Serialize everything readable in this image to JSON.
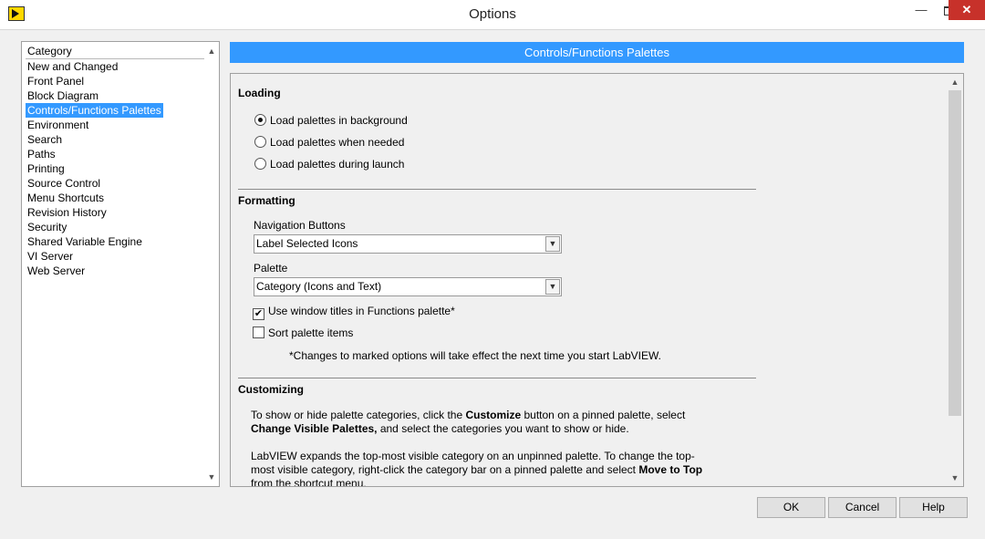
{
  "window": {
    "title": "Options"
  },
  "category_list": {
    "header": "Category",
    "items": [
      "New and Changed",
      "Front Panel",
      "Block Diagram",
      "Controls/Functions Palettes",
      "Environment",
      "Search",
      "Paths",
      "Printing",
      "Source Control",
      "Menu Shortcuts",
      "Revision History",
      "Security",
      "Shared Variable Engine",
      "VI Server",
      "Web Server"
    ],
    "selected": "Controls/Functions Palettes"
  },
  "panel": {
    "header": "Controls/Functions Palettes",
    "loading": {
      "title": "Loading",
      "options": [
        "Load palettes in background",
        "Load palettes when needed",
        "Load palettes during launch"
      ],
      "selected_index": 0
    },
    "formatting": {
      "title": "Formatting",
      "nav_label": "Navigation Buttons",
      "nav_value": "Label Selected Icons",
      "palette_label": "Palette",
      "palette_value": "Category (Icons and Text)",
      "use_window_titles": "Use window titles in Functions palette*",
      "use_window_titles_checked": true,
      "sort_items": "Sort palette items",
      "sort_items_checked": false,
      "note": "*Changes to marked options will take effect the next time you start LabVIEW."
    },
    "customizing": {
      "title": "Customizing",
      "p1_a": "To show or hide palette categories, click the ",
      "p1_b": "Customize",
      "p1_c": " button on a pinned palette, select ",
      "p1_d": "Change Visible Palettes,",
      "p1_e": " and select the categories you want to show or hide.",
      "p2_a": "LabVIEW expands the top-most visible category on an unpinned palette. To change the top-most visible category, right-click the category bar on a pinned palette and select ",
      "p2_b": "Move to Top",
      "p2_c": " from the shortcut menu."
    }
  },
  "buttons": {
    "ok": "OK",
    "cancel": "Cancel",
    "help": "Help"
  }
}
